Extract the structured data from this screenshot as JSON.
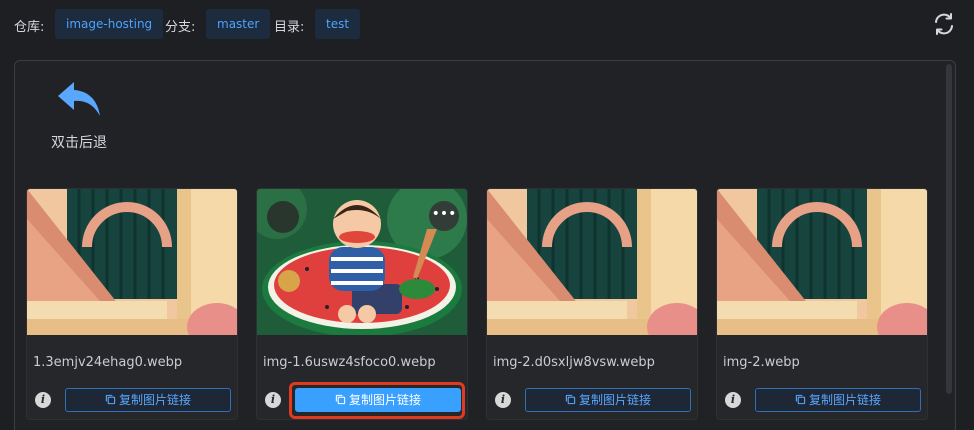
{
  "topbar": {
    "repo_label": "仓库:",
    "repo_value": "image-hosting",
    "branch_label": "分支:",
    "branch_value": "master",
    "dir_label": "目录:",
    "dir_value": "test",
    "refresh_icon": "refresh-icon"
  },
  "back": {
    "label": "双击后退",
    "icon": "back-arrow-icon",
    "color": "#5aa7ff"
  },
  "cards": [
    {
      "filename": "1.3emjv24ehag0.webp",
      "copy_label": "复制图片链接",
      "info": "i",
      "active": false
    },
    {
      "filename": "img-1.6uswz4sfoco0.webp",
      "copy_label": "复制图片链接",
      "info": "i",
      "active": true
    },
    {
      "filename": "img-2.d0sxljw8vsw.webp",
      "copy_label": "复制图片链接",
      "info": "i",
      "active": false
    },
    {
      "filename": "img-2.webp",
      "copy_label": "复制图片链接",
      "info": "i",
      "active": false
    }
  ],
  "more_label": "•••",
  "colors": {
    "accent": "#3aa0ff",
    "highlight": "#e03a21",
    "background": "#1e1f22"
  }
}
